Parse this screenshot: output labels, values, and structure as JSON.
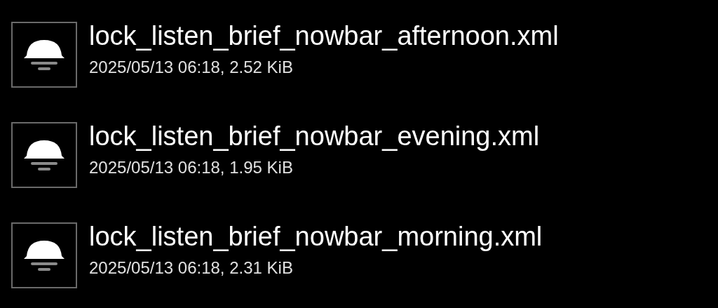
{
  "files": [
    {
      "name": "lock_listen_brief_nowbar_afternoon.xml",
      "details": "2025/05/13 06:18, 2.52 KiB"
    },
    {
      "name": "lock_listen_brief_nowbar_evening.xml",
      "details": "2025/05/13 06:18, 1.95 KiB"
    },
    {
      "name": "lock_listen_brief_nowbar_morning.xml",
      "details": "2025/05/13 06:18, 2.31 KiB"
    }
  ]
}
